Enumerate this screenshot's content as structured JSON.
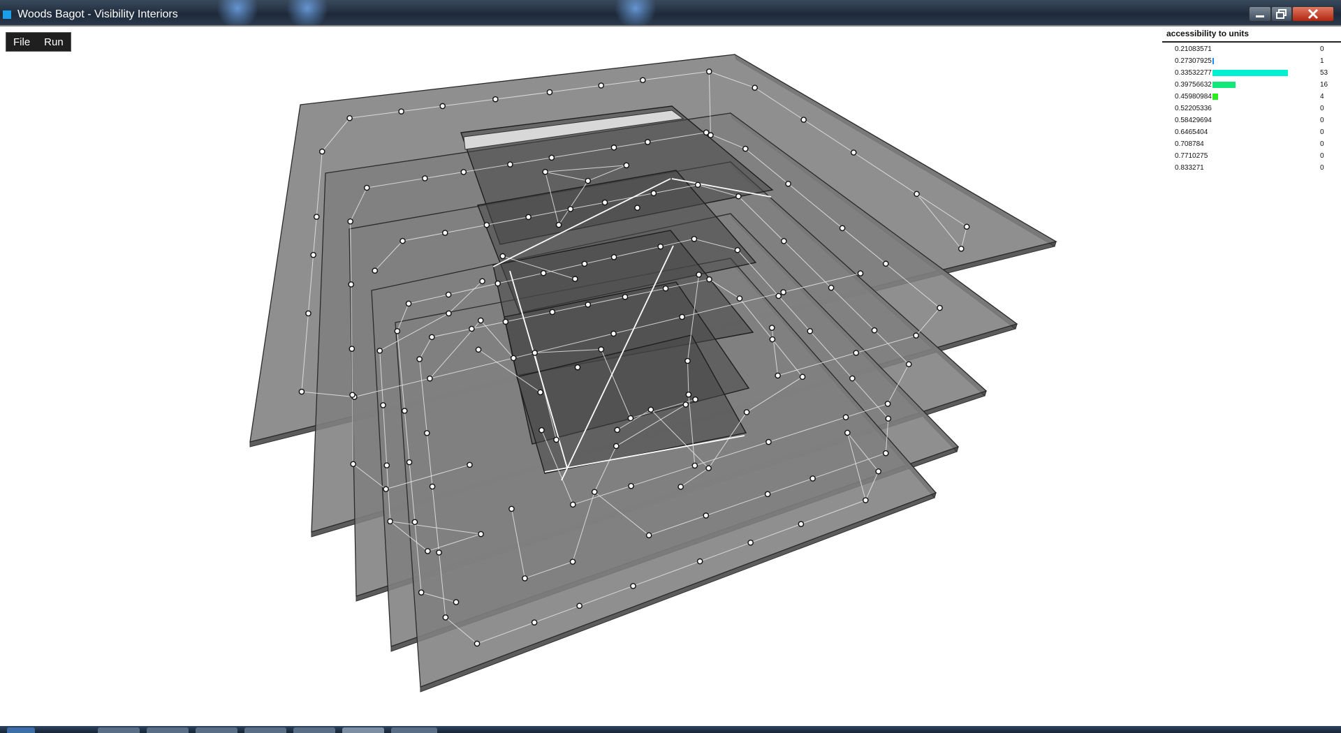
{
  "window": {
    "title": "Woods Bagot - Visibility Interiors",
    "controls": [
      "minimize",
      "maximize",
      "close"
    ]
  },
  "menu": {
    "items": [
      {
        "label": "File"
      },
      {
        "label": "Run"
      }
    ]
  },
  "histogram": {
    "title": "accessibility to units",
    "rows": [
      {
        "label": "0.21083571",
        "count": "0",
        "value": 0,
        "color": "#00e5c8"
      },
      {
        "label": "0.27307925",
        "count": "1",
        "value": 1,
        "color": "#1e8cff"
      },
      {
        "label": "0.33532277",
        "count": "53",
        "value": 53,
        "color": "#00f0d2"
      },
      {
        "label": "0.39756632",
        "count": "16",
        "value": 16,
        "color": "#10e87a"
      },
      {
        "label": "0.45980984",
        "count": "4",
        "value": 4,
        "color": "#2aec20"
      },
      {
        "label": "0.52205336",
        "count": "0",
        "value": 0,
        "color": "#6ef010"
      },
      {
        "label": "0.58429694",
        "count": "0",
        "value": 0,
        "color": "#a8f000"
      },
      {
        "label": "0.6465404",
        "count": "0",
        "value": 0,
        "color": "#e0e800"
      },
      {
        "label": "0.708784",
        "count": "0",
        "value": 0,
        "color": "#f0b000"
      },
      {
        "label": "0.7710275",
        "count": "0",
        "value": 0,
        "color": "#f07000"
      },
      {
        "label": "0.833271",
        "count": "0",
        "value": 0,
        "color": "#f03000"
      }
    ]
  }
}
